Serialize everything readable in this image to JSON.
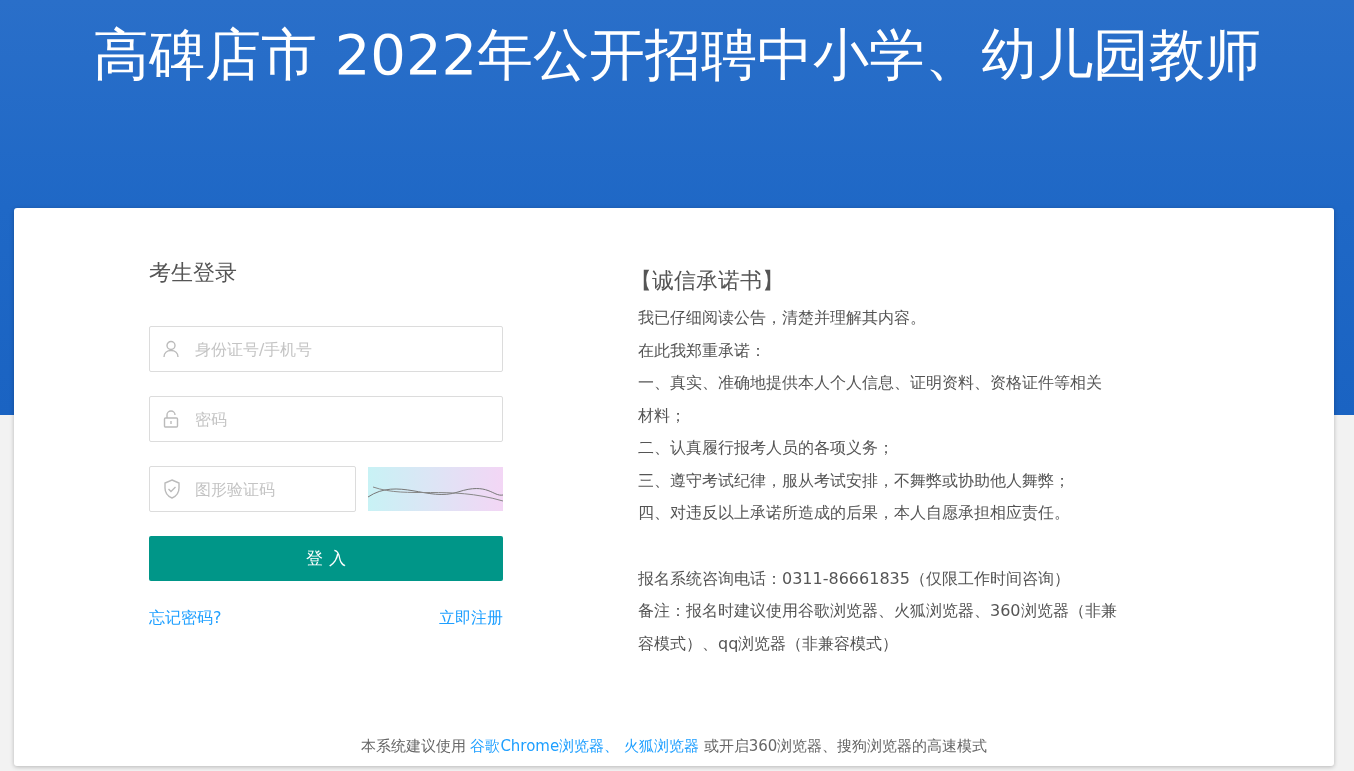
{
  "header": {
    "title": "高碑店市 2022年公开招聘中小学、幼儿园教师"
  },
  "login": {
    "title": "考生登录",
    "fields": [
      {
        "kind": "user",
        "placeholder": "身份证号/手机号"
      },
      {
        "kind": "password",
        "placeholder": "密码"
      },
      {
        "kind": "captcha",
        "placeholder": "图形验证码"
      }
    ],
    "submit": "登 入",
    "links": [
      "忘记密码?",
      "立即注册"
    ]
  },
  "pledge": {
    "title": "【诚信承诺书】",
    "lines": [
      "我已仔细阅读公告，清楚并理解其内容。",
      "在此我郑重承诺：",
      "一、真实、准确地提供本人个人信息、证明资料、资格证件等相关材料；",
      "二、认真履行报考人员的各项义务；",
      "三、遵守考试纪律，服从考试安排，不舞弊或协助他人舞弊；",
      "四、对违反以上承诺所造成的后果，本人自愿承担相应责任。"
    ],
    "notes": [
      "报名系统咨询电话：0311-86661835（仅限工作时间咨询）",
      "备注：报名时建议使用谷歌浏览器、火狐浏览器、360浏览器（非兼容模式）、qq浏览器（非兼容模式）"
    ]
  },
  "footer": {
    "before": "本系统建议使用 ",
    "links": [
      "谷歌Chrome浏览器、",
      "火狐浏览器"
    ],
    "after": " 或开启360浏览器、搜狗浏览器的高速模式"
  }
}
